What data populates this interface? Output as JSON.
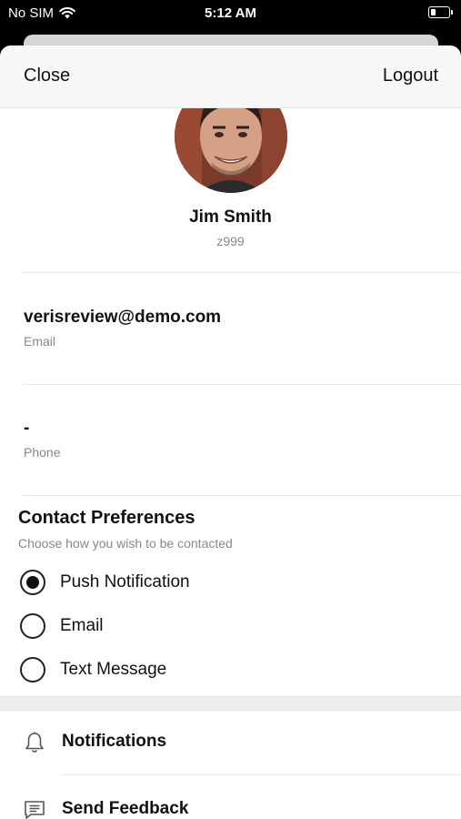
{
  "status_bar": {
    "carrier": "No SIM",
    "time": "5:12 AM"
  },
  "header": {
    "close_label": "Close",
    "logout_label": "Logout"
  },
  "profile": {
    "name": "Jim Smith",
    "user_id": "z999"
  },
  "fields": {
    "email_value": "verisreview@demo.com",
    "email_label": "Email",
    "phone_value": "-",
    "phone_label": "Phone"
  },
  "contact_preferences": {
    "title": "Contact Preferences",
    "subtitle": "Choose how you wish to be contacted",
    "options": [
      {
        "label": "Push Notification",
        "selected": true
      },
      {
        "label": "Email",
        "selected": false
      },
      {
        "label": "Text Message",
        "selected": false
      }
    ]
  },
  "menu": {
    "items": [
      {
        "label": "Notifications",
        "icon": "bell-icon"
      },
      {
        "label": "Send Feedback",
        "icon": "message-icon"
      }
    ]
  }
}
